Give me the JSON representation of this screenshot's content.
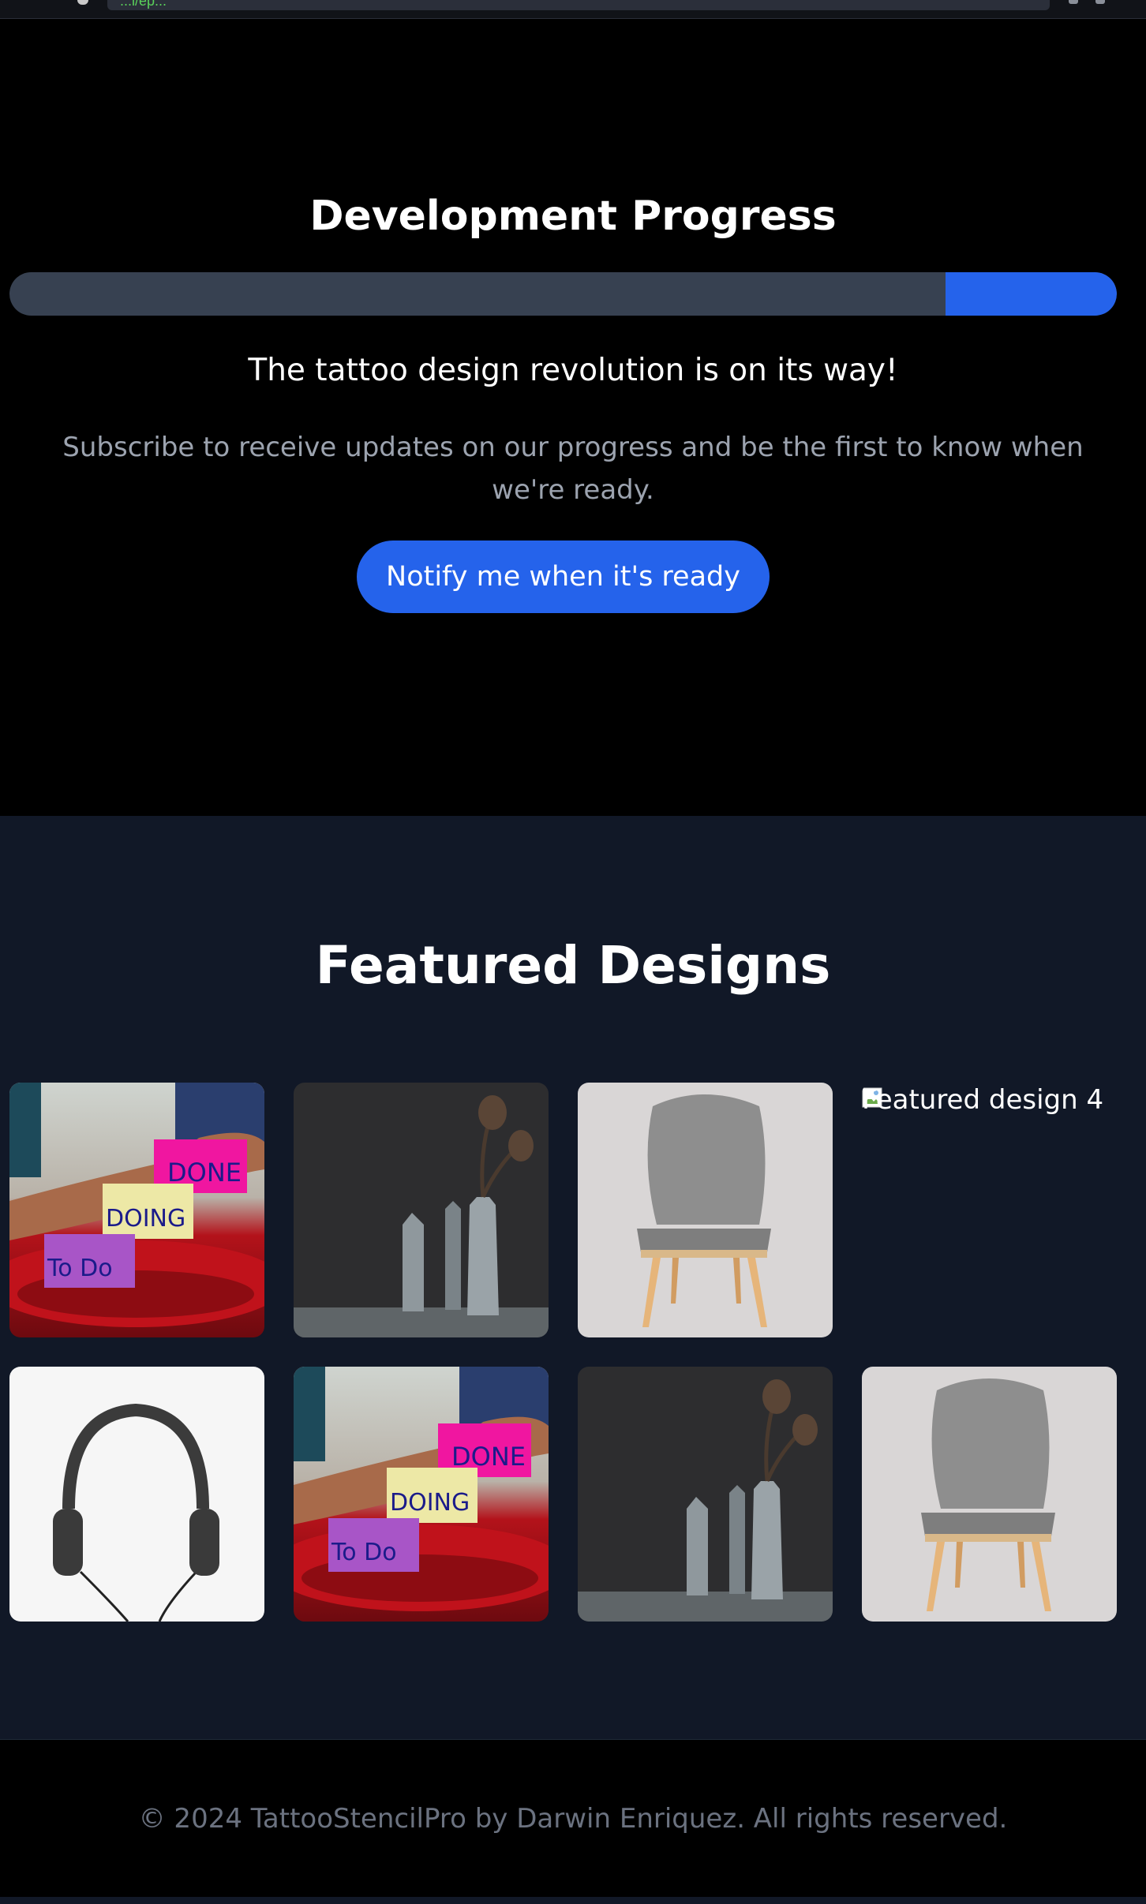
{
  "browser": {
    "url_fragment": "...l/ep..."
  },
  "progress": {
    "title": "Development Progress",
    "fraction": 0.155,
    "tagline": "The tattoo design revolution is on its way!",
    "subtitle": "Subscribe to receive updates on our progress and be the first to know when we're ready.",
    "button_label": "Notify me when it's ready"
  },
  "featured": {
    "title": "Featured Designs",
    "broken_alt": "Featured design 4"
  },
  "footer": {
    "text": "© 2024 TattooStencilPro by Darwin Enriquez. All rights reserved."
  },
  "colors": {
    "accent": "#2563eb",
    "track": "#374151",
    "section_bg": "#111827",
    "muted_text": "#9ca3af"
  }
}
